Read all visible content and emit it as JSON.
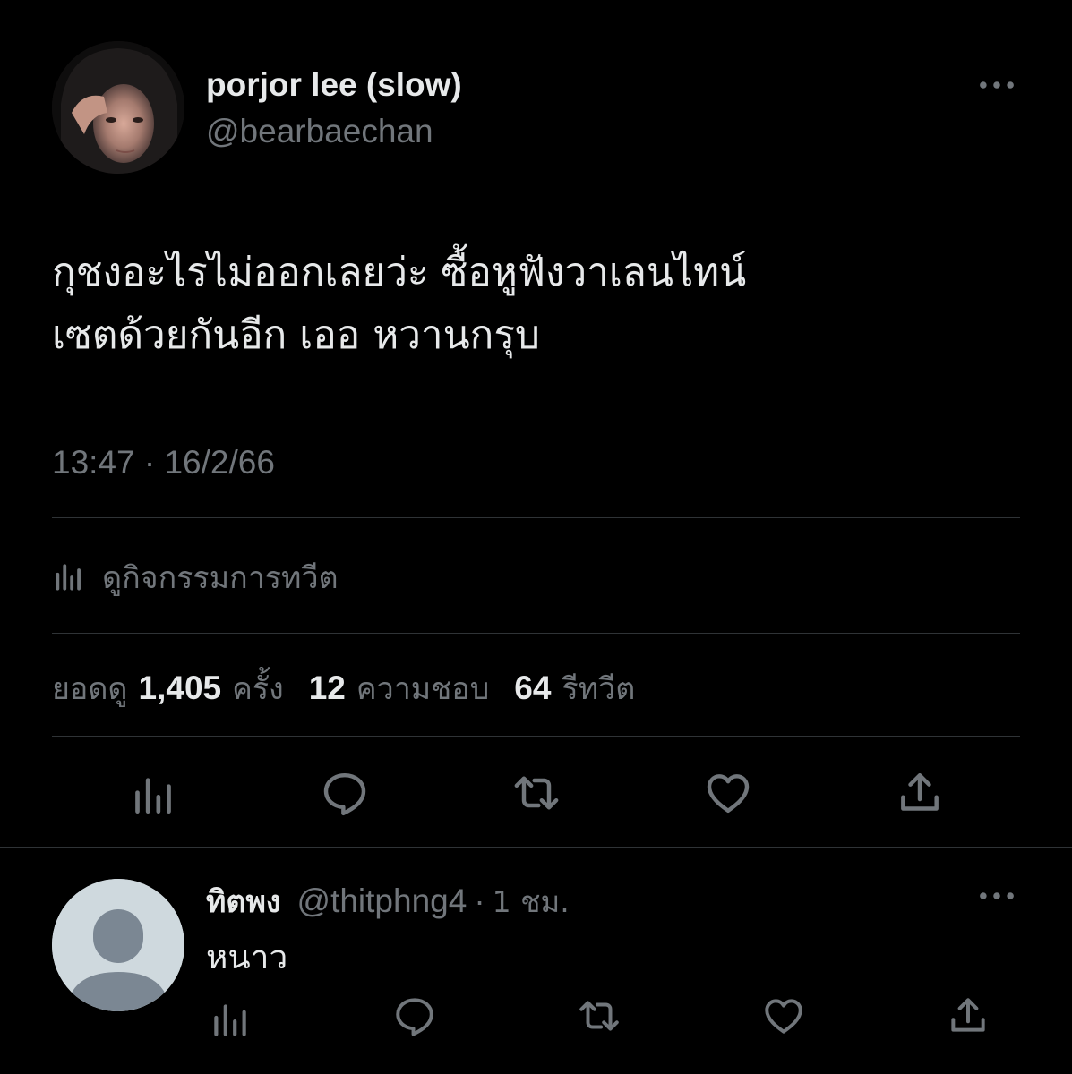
{
  "tweet": {
    "author": {
      "display_name": "porjor lee (slow)",
      "handle": "@bearbaechan"
    },
    "text": "กุชงอะไรไม่ออกเลยว่ะ ซื้อหูฟังวาเลนไทน์\nเซตด้วยกันอีก เออ หวานกรุบ",
    "timestamp": "13:47 · 16/2/66",
    "activity_label": "ดูกิจกรรมการทวีต",
    "stats": {
      "views_prefix": "ยอดดู",
      "views_count": "1,405",
      "views_suffix": "ครั้ง",
      "likes_count": "12",
      "likes_label": "ความชอบ",
      "retweets_count": "64",
      "retweets_label": "รีทวีต"
    },
    "actions": [
      {
        "icon": "analytics-icon"
      },
      {
        "icon": "reply-icon"
      },
      {
        "icon": "retweet-icon"
      },
      {
        "icon": "like-icon"
      },
      {
        "icon": "share-icon"
      }
    ]
  },
  "reply": {
    "author": {
      "display_name": "ทิตพง",
      "handle": "@thitphng4",
      "time": "1 ชม."
    },
    "separator": "·",
    "text": "หนาว",
    "actions": [
      {
        "icon": "analytics-icon"
      },
      {
        "icon": "reply-icon"
      },
      {
        "icon": "retweet-icon"
      },
      {
        "icon": "like-icon"
      },
      {
        "icon": "share-icon"
      }
    ]
  },
  "colors": {
    "background": "#000000",
    "primary_text": "#e7e9ea",
    "secondary_text": "#71767b",
    "divider": "#2f3336",
    "default_avatar_bg": "#cfd9de",
    "default_avatar_fg": "#7b8793"
  }
}
